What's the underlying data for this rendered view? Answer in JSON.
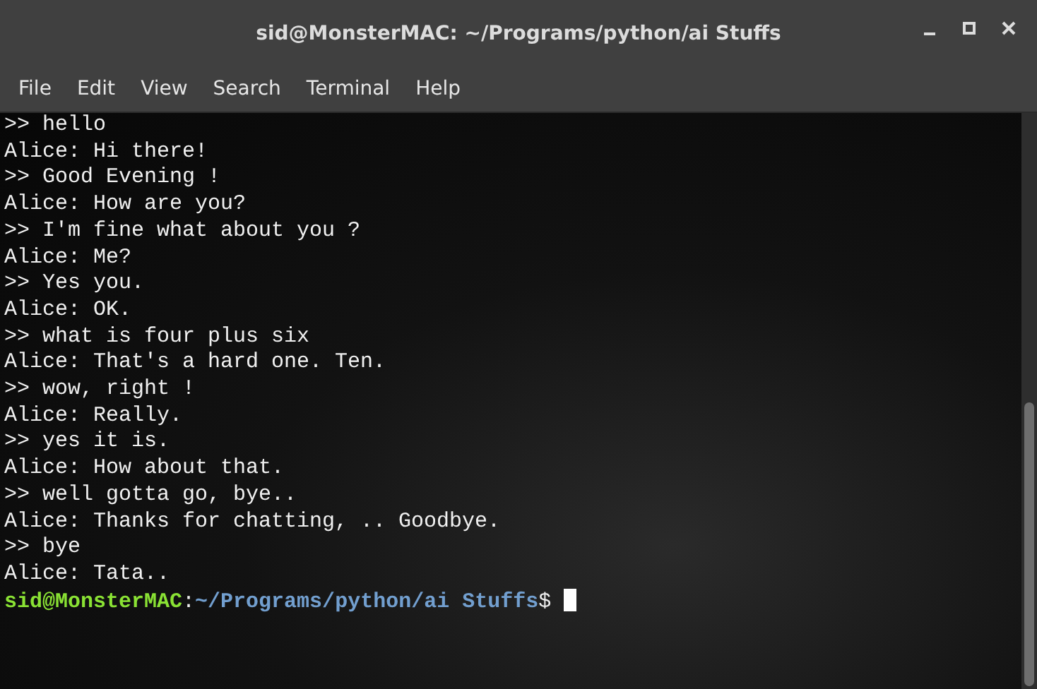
{
  "window": {
    "title": "sid@MonsterMAC: ~/Programs/python/ai Stuffs"
  },
  "menu": [
    "File",
    "Edit",
    "View",
    "Search",
    "Terminal",
    "Help"
  ],
  "terminal": {
    "lines": [
      ">> hello",
      "Alice: Hi there!",
      ">> Good Evening !",
      "Alice: How are you?",
      ">> I'm fine what about you ?",
      "Alice: Me?",
      ">> Yes you.",
      "Alice: OK.",
      ">> what is four plus six",
      "Alice: That's a hard one. Ten.",
      ">> wow, right !",
      "Alice: Really.",
      ">> yes it is.",
      "Alice: How about that.",
      ">> well gotta go, bye..",
      "Alice: Thanks for chatting, .. Goodbye.",
      ">> bye",
      "Alice: Tata.."
    ],
    "prompt": {
      "user_host": "sid@MonsterMAC",
      "separator": ":",
      "path": "~/Programs/python/ai Stuffs",
      "suffix": "$"
    }
  }
}
